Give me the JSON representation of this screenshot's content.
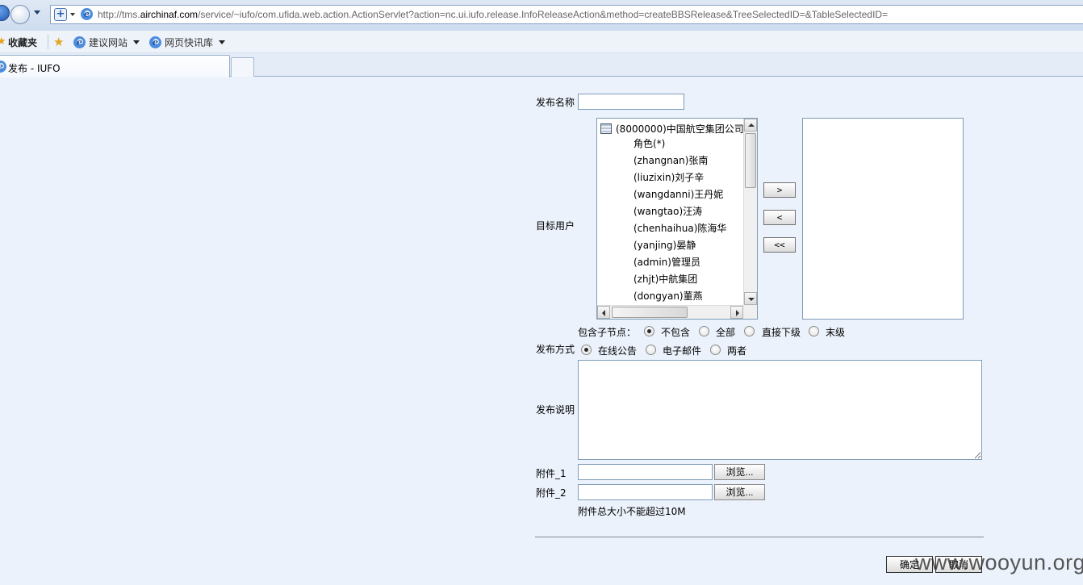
{
  "browser": {
    "url_prefix": "http://tms.",
    "url_domain": "airchinaf.com",
    "url_path": "/service/~iufo/com.ufida.web.action.ActionServlet?action=nc.ui.iufo.release.InfoReleaseAction&method=createBBSRelease&TreeSelectedID=&TableSelectedID=",
    "favorites_label": "收藏夹",
    "favbar_items": [
      "建议网站",
      "网页快讯库"
    ],
    "tab_title": "发布 - IUFO"
  },
  "form": {
    "name_label": "发布名称",
    "name_value": "",
    "target_label": "目标用户",
    "tree_root": "(8000000)中国航空集团公司",
    "tree_items": [
      "角色(*)",
      "(zhangnan)张南",
      "(liuzixin)刘子辛",
      "(wangdanni)王丹妮",
      "(wangtao)汪涛",
      "(chenhaihua)陈海华",
      "(yanjing)晏静",
      "(admin)管理员",
      "(zhjt)中航集团",
      "(dongyan)董燕"
    ],
    "move_buttons": [
      ">",
      "<",
      "<<"
    ],
    "subnode_label": "包含子节点：",
    "subnode_options": [
      "不包含",
      "全部",
      "直接下级",
      "末级"
    ],
    "subnode_selected": "不包含",
    "method_label": "发布方式",
    "method_options": [
      "在线公告",
      "电子邮件",
      "两者"
    ],
    "method_selected": "在线公告",
    "desc_label": "发布说明",
    "attach1_label": "附件_1",
    "attach2_label": "附件_2",
    "browse_label": "浏览...",
    "attach_note": "附件总大小不能超过10M",
    "ok_label": "确定",
    "cancel_label": "取消"
  },
  "watermark": "www.wooyun.org"
}
